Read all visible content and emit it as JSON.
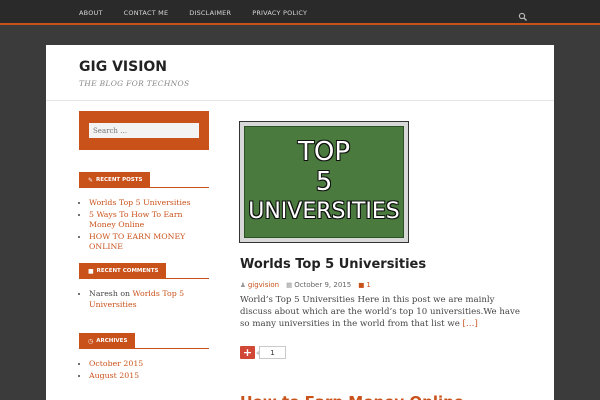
{
  "nav": {
    "items": [
      "ABOUT",
      "CONTACT ME",
      "DISCLAIMER",
      "PRIVACY POLICY"
    ],
    "search_icon": "search-icon"
  },
  "site": {
    "title": "GIG VISION",
    "description": "THE BLOG FOR TECHNOS"
  },
  "sidebar": {
    "search_placeholder": "Search …",
    "recent_posts": {
      "title": "RECENT POSTS",
      "icon": "pencil-icon",
      "items": [
        "Worlds Top 5 Universities",
        "5 Ways To How To Earn Money Online",
        "HOW TO EARN MONEY ONLINE"
      ]
    },
    "recent_comments": {
      "title": "RECENT COMMENTS",
      "icon": "comment-icon",
      "items": [
        {
          "author": "Naresh",
          "on": "on",
          "post": "Worlds Top 5 Universities"
        }
      ]
    },
    "archives": {
      "title": "ARCHIVES",
      "icon": "clock-icon",
      "items": [
        "October 2015",
        "August 2015"
      ]
    }
  },
  "post": {
    "image_text": [
      "TOP",
      "5",
      "UNIVERSITIES"
    ],
    "title": "Worlds Top 5 Universities",
    "author": "gigvision",
    "date": "October 9, 2015",
    "comments": "1",
    "excerpt": "World’s Top 5 Universities Here in this post we are mainly discuss about which are the world’s top 10 universities.We have so many universities in the world from that list we",
    "read_more": "[…]",
    "share_count": "1",
    "share_label": "+"
  },
  "next_post": {
    "title": "How to Earn Money Online"
  },
  "colors": {
    "accent": "#c9521b",
    "nav_bg": "#2a2a2a",
    "page_bg": "#3b3b3b"
  }
}
